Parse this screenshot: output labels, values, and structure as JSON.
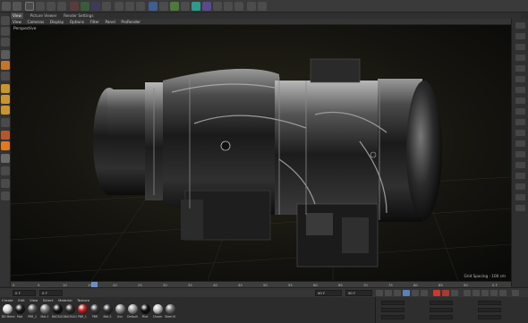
{
  "app": {
    "tabs": [
      "View",
      "Picture Viewer",
      "Render Settings"
    ],
    "active_tab": "View"
  },
  "viewport": {
    "menu": [
      "View",
      "Cameras",
      "Display",
      "Options",
      "Filter",
      "Panel",
      "ProRender"
    ],
    "label": "Perspective",
    "grid_spacing": "Grid Spacing : 100 cm"
  },
  "timeline": {
    "ticks": [
      "0",
      "5",
      "10",
      "15",
      "20",
      "25",
      "30",
      "35",
      "40",
      "45",
      "50",
      "55",
      "60",
      "65",
      "70",
      "75",
      "80",
      "85",
      "90",
      "0 F"
    ],
    "current_frame": 0
  },
  "transport": {
    "start_field": "0 F",
    "current_field": "0 F",
    "end_field": "90 F",
    "max_field": "90 F"
  },
  "material_manager": {
    "menu": [
      "Create",
      "Edit",
      "View",
      "Select",
      "Material",
      "Texture"
    ],
    "materials": [
      {
        "label": "BD Metal",
        "color": "#d8d8d8"
      },
      {
        "label": "Mat",
        "color": "#1a1a1a"
      },
      {
        "label": "PRR_1",
        "color": "#595959"
      },
      {
        "label": "Mat.1",
        "color": "#7a7a7a"
      },
      {
        "label": "BACKLIG",
        "color": "#151515"
      },
      {
        "label": "BACKLIG",
        "color": "#2a2a2a"
      },
      {
        "label": "PBR_1",
        "color": "#c02020"
      },
      {
        "label": "PBR",
        "color": "#3a3a3a"
      },
      {
        "label": "Mat.2",
        "color": "#2f2f2f"
      },
      {
        "label": "Gun",
        "color": "#8b8b8b"
      },
      {
        "label": "Default",
        "color": "#9a9a9a"
      },
      {
        "label": "Pilot",
        "color": "#101010"
      },
      {
        "label": "Chrom",
        "color": "#c0c0c0"
      },
      {
        "label": "Steel.M",
        "color": "#6e6e6e"
      }
    ]
  },
  "colors": {
    "accent_blue": "#6d8fbf",
    "record_red": "#c83a2f"
  }
}
